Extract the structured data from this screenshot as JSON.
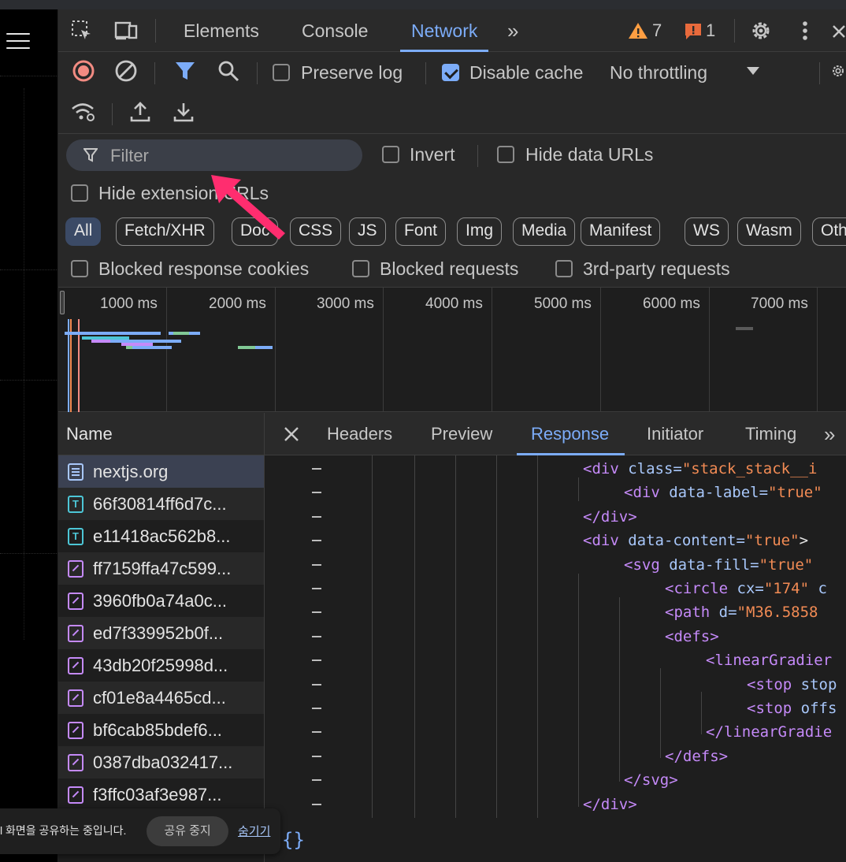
{
  "app": {
    "menu_icon": "hamburger-icon"
  },
  "devtools": {
    "tabs": [
      {
        "label": "Elements"
      },
      {
        "label": "Console"
      },
      {
        "label": "Network"
      }
    ],
    "more_tabs_glyph": "»",
    "warning_count": "7",
    "error_count": "1",
    "icons": [
      "inspect-element-icon",
      "device-toolbar-icon",
      "warning-icon",
      "error-icon",
      "gear-icon",
      "kebab-menu-icon",
      "close-icon"
    ]
  },
  "network_toolbar": {
    "preserve_log_label": "Preserve log",
    "preserve_log_checked": false,
    "disable_cache_label": "Disable cache",
    "disable_cache_checked": true,
    "throttling_value": "No throttling"
  },
  "filter": {
    "placeholder": "Filter",
    "invert_label": "Invert",
    "hide_data_urls_label": "Hide data URLs",
    "hide_extension_urls_label": "Hide extension URLs",
    "type_chips": [
      "All",
      "Fetch/XHR",
      "Doc",
      "CSS",
      "JS",
      "Font",
      "Img",
      "Media",
      "Manifest",
      "WS",
      "Wasm",
      "Oth"
    ],
    "blocked_cookies_label": "Blocked response cookies",
    "blocked_requests_label": "Blocked requests",
    "third_party_label": "3rd-party requests"
  },
  "overview": {
    "ticks": [
      "1000 ms",
      "2000 ms",
      "3000 ms",
      "4000 ms",
      "5000 ms",
      "6000 ms",
      "7000 ms"
    ]
  },
  "requests": {
    "header": "Name",
    "rows": [
      {
        "name": "nextjs.org",
        "type": "doc"
      },
      {
        "name": "66f30814ff6d7c...",
        "type": "txt"
      },
      {
        "name": "e11418ac562b8...",
        "type": "txt"
      },
      {
        "name": "ff7159ffa47c599...",
        "type": "img"
      },
      {
        "name": "3960fb0a74a0c...",
        "type": "img"
      },
      {
        "name": "ed7f339952b0f...",
        "type": "img"
      },
      {
        "name": "43db20f25998d...",
        "type": "img"
      },
      {
        "name": "cf01e8a4465cd...",
        "type": "img"
      },
      {
        "name": "bf6cab85bdef6...",
        "type": "img"
      },
      {
        "name": "0387dba032417...",
        "type": "img"
      },
      {
        "name": "f3ffc03af3e987...",
        "type": "img"
      }
    ]
  },
  "detail": {
    "tabs": [
      "Headers",
      "Preview",
      "Response",
      "Initiator",
      "Timing"
    ],
    "active_tab": "Response",
    "code_lines": [
      {
        "indent": 0,
        "parts": [
          [
            "tag",
            "<div "
          ],
          [
            "attr",
            "class="
          ],
          [
            "val",
            "\"stack_stack__i"
          ]
        ]
      },
      {
        "indent": 1,
        "parts": [
          [
            "tag",
            "<div "
          ],
          [
            "attr",
            "data-label="
          ],
          [
            "val",
            "\"true\""
          ]
        ]
      },
      {
        "indent": 0,
        "parts": [
          [
            "tag",
            "</div>"
          ]
        ]
      },
      {
        "indent": 0,
        "parts": [
          [
            "tag",
            "<div "
          ],
          [
            "attr",
            "data-content="
          ],
          [
            "val",
            "\"true\""
          ],
          [
            "plain",
            ">"
          ]
        ]
      },
      {
        "indent": 1,
        "parts": [
          [
            "tag",
            "<svg "
          ],
          [
            "attr",
            "data-fill="
          ],
          [
            "val",
            "\"true\""
          ]
        ]
      },
      {
        "indent": 2,
        "parts": [
          [
            "tag",
            "<circle "
          ],
          [
            "attr",
            "cx="
          ],
          [
            "val",
            "\"174\""
          ],
          [
            "attr",
            " c"
          ]
        ]
      },
      {
        "indent": 2,
        "parts": [
          [
            "tag",
            "<path "
          ],
          [
            "attr",
            "d="
          ],
          [
            "val",
            "\"M36.5858"
          ]
        ]
      },
      {
        "indent": 2,
        "parts": [
          [
            "tag",
            "<defs>"
          ]
        ]
      },
      {
        "indent": 3,
        "parts": [
          [
            "tag",
            "<linearGradier"
          ]
        ]
      },
      {
        "indent": 4,
        "parts": [
          [
            "tag",
            "<stop "
          ],
          [
            "attr",
            "stop"
          ]
        ]
      },
      {
        "indent": 4,
        "parts": [
          [
            "tag",
            "<stop "
          ],
          [
            "attr",
            "offs"
          ]
        ]
      },
      {
        "indent": 3,
        "parts": [
          [
            "tag",
            "</linearGradie"
          ]
        ]
      },
      {
        "indent": 2,
        "parts": [
          [
            "tag",
            "</defs>"
          ]
        ]
      },
      {
        "indent": 1,
        "parts": [
          [
            "tag",
            "</svg>"
          ]
        ]
      },
      {
        "indent": 0,
        "parts": [
          [
            "tag",
            "</div>"
          ]
        ]
      }
    ],
    "format_glyph": "{}"
  },
  "share_notice": {
    "message": "l 화면을 공유하는 중입니다.",
    "stop_label": "공유 중지",
    "hide_label": "숨기기"
  },
  "colors": {
    "accent": "#7cacf8",
    "record_red": "#f28b82",
    "warning": "#ff9e42",
    "pointer_arrow": "#ff2d6f"
  }
}
